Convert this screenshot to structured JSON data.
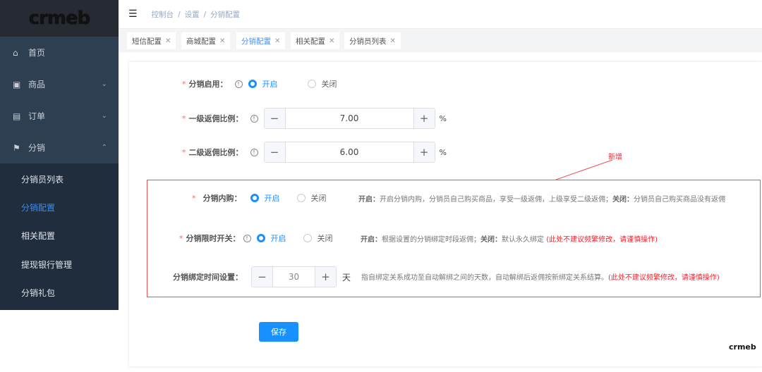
{
  "brand": {
    "logo": "crmeb",
    "accent": "#1890ff",
    "warn": "#f5222d"
  },
  "sidebar": {
    "items": [
      {
        "label": "首页",
        "icon": "home-icon"
      },
      {
        "label": "商品",
        "icon": "bag-icon"
      },
      {
        "label": "订单",
        "icon": "briefcase-icon"
      },
      {
        "label": "分销",
        "icon": "flag-icon"
      }
    ],
    "sub": [
      {
        "label": "分销员列表"
      },
      {
        "label": "分销配置",
        "active": true
      },
      {
        "label": "相关配置"
      },
      {
        "label": "提现银行管理"
      },
      {
        "label": "分销礼包"
      }
    ]
  },
  "header": {
    "breadcrumb": [
      "控制台",
      "设置",
      "分销配置"
    ]
  },
  "tabs": [
    {
      "label": "短信配置"
    },
    {
      "label": "商城配置"
    },
    {
      "label": "分销配置",
      "active": true
    },
    {
      "label": "相关配置"
    },
    {
      "label": "分销员列表"
    }
  ],
  "form": {
    "enable": {
      "label": "分销启用：",
      "on": "开启",
      "off": "关闭",
      "value": "开启"
    },
    "level1": {
      "label": "一级返佣比例：",
      "value": "7.00",
      "unit": "%"
    },
    "level2": {
      "label": "二级返佣比例：",
      "value": "6.00",
      "unit": "%"
    },
    "new_tag": "新增",
    "self_buy": {
      "label": "分销内购：",
      "on": "开启",
      "off": "关闭",
      "value": "开启",
      "desc_on_k": "开启：",
      "desc_on": "开启分销内购，分销员自己购买商品，享受一级返佣，上级享受二级返佣；",
      "desc_off_k": "关闭：",
      "desc_off": "分销员自己购买商品没有返佣"
    },
    "time_switch": {
      "label": "分销限时开关：",
      "on": "开启",
      "off": "关闭",
      "value": "开启",
      "desc_on_k": "开启：",
      "desc_on": "根据设置的分销绑定时段返佣；",
      "desc_off_k": "关闭：",
      "desc_off": "默认永久绑定",
      "warn": "(此处不建议频繁修改，请谨慎操作)"
    },
    "bind_time": {
      "label": "分销绑定时间设置：",
      "value": "30",
      "unit": "天",
      "desc": "指自绑定关系成功至自动解绑之间的天数，自动解绑后返佣按新绑定关系结算。",
      "warn": "(此处不建议频繁修改，请谨慎操作)"
    },
    "save": "保存"
  },
  "watermark": "crmeb"
}
